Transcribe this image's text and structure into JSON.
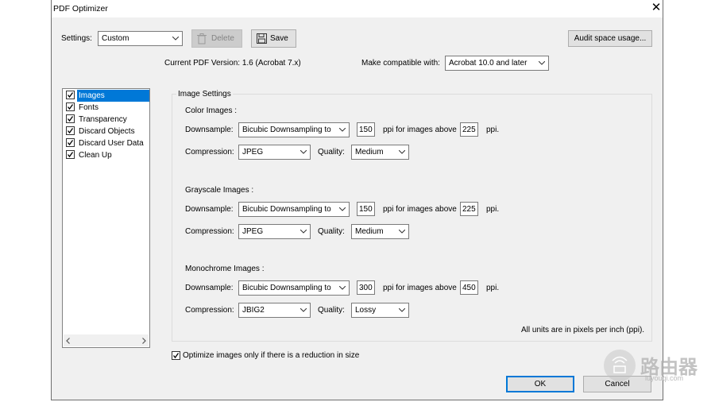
{
  "window": {
    "title": "PDF Optimizer"
  },
  "top": {
    "settings_label": "Settings:",
    "settings_value": "Custom",
    "delete_label": "Delete",
    "save_label": "Save",
    "audit_label": "Audit space usage..."
  },
  "version": {
    "current_label": "Current PDF Version: 1.6 (Acrobat 7.x)",
    "compat_label": "Make compatible with:",
    "compat_value": "Acrobat 10.0 and later"
  },
  "panels": [
    {
      "label": "Images",
      "checked": true,
      "selected": true
    },
    {
      "label": "Fonts",
      "checked": true
    },
    {
      "label": "Transparency",
      "checked": true
    },
    {
      "label": "Discard Objects",
      "checked": true
    },
    {
      "label": "Discard User Data",
      "checked": true
    },
    {
      "label": "Clean Up",
      "checked": true
    }
  ],
  "image_settings": {
    "title": "Image Settings",
    "downsample_label": "Downsample:",
    "compression_label": "Compression:",
    "quality_label": "Quality:",
    "ppi_above_label": "ppi for images above",
    "ppi_label": "ppi.",
    "color": {
      "title": "Color Images :",
      "method": "Bicubic Downsampling to",
      "ppi": "150",
      "above": "225",
      "compression": "JPEG",
      "quality": "Medium"
    },
    "grayscale": {
      "title": "Grayscale Images :",
      "method": "Bicubic Downsampling to",
      "ppi": "150",
      "above": "225",
      "compression": "JPEG",
      "quality": "Medium"
    },
    "mono": {
      "title": "Monochrome Images :",
      "method": "Bicubic Downsampling to",
      "ppi": "300",
      "above": "450",
      "compression": "JBIG2",
      "quality": "Lossy"
    },
    "units_note": "All units are in pixels per inch (ppi)."
  },
  "optimize_only_label": "Optimize images only if there is a reduction in size",
  "buttons": {
    "ok": "OK",
    "cancel": "Cancel"
  },
  "watermark": {
    "cn": "路由器",
    "url": "luyouqi.com"
  },
  "colors": {
    "selection": "#0078d7",
    "ok_border": "#0078d7"
  }
}
